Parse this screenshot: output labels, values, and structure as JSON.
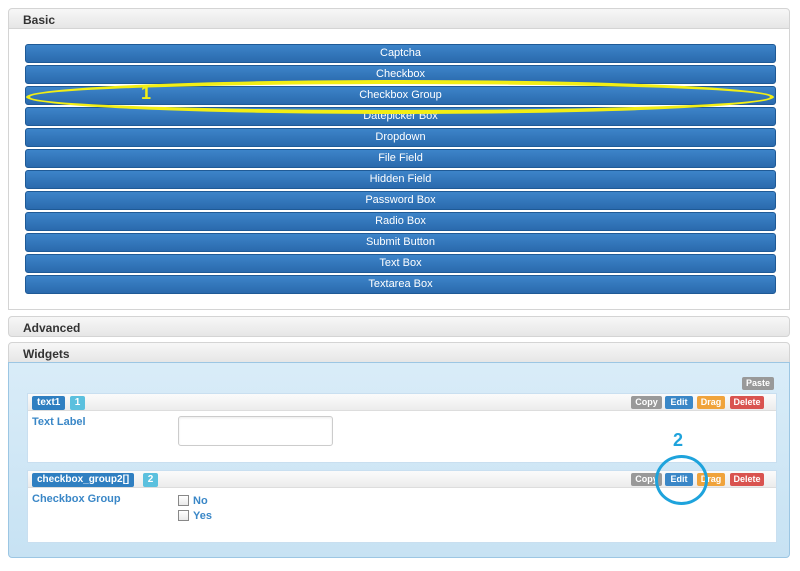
{
  "sections": {
    "basic": "Basic",
    "advanced": "Advanced",
    "widgets": "Widgets"
  },
  "basic_fields": [
    "Captcha",
    "Checkbox",
    "Checkbox Group",
    "Datepicker Box",
    "Dropdown",
    "File Field",
    "Hidden Field",
    "Password Box",
    "Radio Box",
    "Submit Button",
    "Text Box",
    "Textarea Box"
  ],
  "widgets_toolbar": {
    "paste": "Paste"
  },
  "widgets": [
    {
      "name": "text1",
      "number": "1",
      "label": "Text Label",
      "actions": {
        "copy": "Copy",
        "edit": "Edit",
        "drag": "Drag",
        "delete": "Delete"
      }
    },
    {
      "name": "checkbox_group2[]",
      "number": "2",
      "label": "Checkbox Group",
      "options": [
        "No",
        "Yes"
      ],
      "actions": {
        "copy": "Copy",
        "edit": "Edit",
        "drag": "Drag",
        "delete": "Delete"
      }
    }
  ],
  "annotations": {
    "first": {
      "text": "1",
      "color": "#f2ee15"
    },
    "second": {
      "text": "2",
      "color": "#1ea3dc"
    }
  },
  "colors": {
    "button_blue": "#2f7fc1",
    "label_blue": "#3a87c7",
    "drag_orange": "#f0a33b",
    "delete_red": "#d9534f"
  }
}
